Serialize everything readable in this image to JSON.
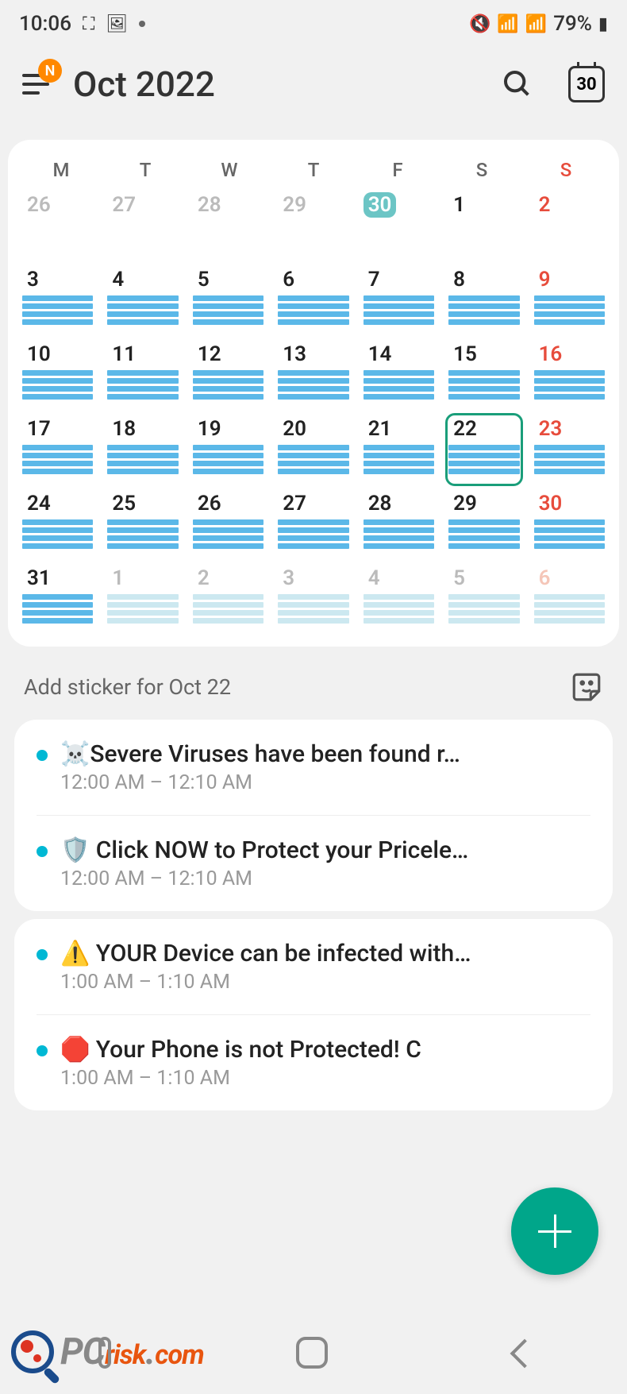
{
  "statusBar": {
    "time": "10:06",
    "battery": "79%"
  },
  "header": {
    "badge": "N",
    "title": "Oct  2022",
    "todayDate": "30"
  },
  "calendar": {
    "weekdays": [
      "M",
      "T",
      "W",
      "T",
      "F",
      "S",
      "S"
    ],
    "weeks": [
      [
        {
          "n": "26",
          "prev": true,
          "bars": 0
        },
        {
          "n": "27",
          "prev": true,
          "bars": 0
        },
        {
          "n": "28",
          "prev": true,
          "bars": 0
        },
        {
          "n": "29",
          "prev": true,
          "bars": 0
        },
        {
          "n": "30",
          "prev": true,
          "today": true,
          "bars": 0
        },
        {
          "n": "1",
          "bars": 0
        },
        {
          "n": "2",
          "sunday": true,
          "bars": 0
        }
      ],
      [
        {
          "n": "3",
          "bars": 4
        },
        {
          "n": "4",
          "bars": 4
        },
        {
          "n": "5",
          "bars": 4
        },
        {
          "n": "6",
          "bars": 4
        },
        {
          "n": "7",
          "bars": 4
        },
        {
          "n": "8",
          "bars": 4
        },
        {
          "n": "9",
          "sunday": true,
          "bars": 4
        }
      ],
      [
        {
          "n": "10",
          "bars": 4
        },
        {
          "n": "11",
          "bars": 4
        },
        {
          "n": "12",
          "bars": 4
        },
        {
          "n": "13",
          "bars": 4
        },
        {
          "n": "14",
          "bars": 4
        },
        {
          "n": "15",
          "bars": 4
        },
        {
          "n": "16",
          "sunday": true,
          "bars": 4
        }
      ],
      [
        {
          "n": "17",
          "bars": 4
        },
        {
          "n": "18",
          "bars": 4
        },
        {
          "n": "19",
          "bars": 4
        },
        {
          "n": "20",
          "bars": 4
        },
        {
          "n": "21",
          "bars": 4
        },
        {
          "n": "22",
          "selected": true,
          "bars": 4
        },
        {
          "n": "23",
          "sunday": true,
          "bars": 4
        }
      ],
      [
        {
          "n": "24",
          "bars": 4
        },
        {
          "n": "25",
          "bars": 4
        },
        {
          "n": "26",
          "bars": 4
        },
        {
          "n": "27",
          "bars": 4
        },
        {
          "n": "28",
          "bars": 4
        },
        {
          "n": "29",
          "bars": 4
        },
        {
          "n": "30",
          "sunday": true,
          "bars": 4
        }
      ],
      [
        {
          "n": "31",
          "bars": 4
        },
        {
          "n": "1",
          "next": true,
          "bars": 4
        },
        {
          "n": "2",
          "next": true,
          "bars": 4
        },
        {
          "n": "3",
          "next": true,
          "bars": 4
        },
        {
          "n": "4",
          "next": true,
          "bars": 4
        },
        {
          "n": "5",
          "next": true,
          "bars": 4
        },
        {
          "n": "6",
          "next": true,
          "sunday": true,
          "bars": 4
        }
      ]
    ]
  },
  "sticker": {
    "label": "Add sticker for Oct 22"
  },
  "events": [
    {
      "title": "☠️Severe Viruses have been found r…",
      "time": "12:00 AM – 12:10 AM"
    },
    {
      "title": "🛡️ Click NOW to Protect your Pricele…",
      "time": "12:00 AM – 12:10 AM"
    },
    {
      "title": "⚠️ YOUR Device can be infected with…",
      "time": "1:00 AM – 1:10 AM"
    },
    {
      "title": "🛑 Your Phone is not Protected! C",
      "time": "1:00 AM – 1:10 AM"
    }
  ],
  "watermark": {
    "pc": "PC",
    "risk": "risk",
    "dot": ".",
    "com": "com"
  }
}
